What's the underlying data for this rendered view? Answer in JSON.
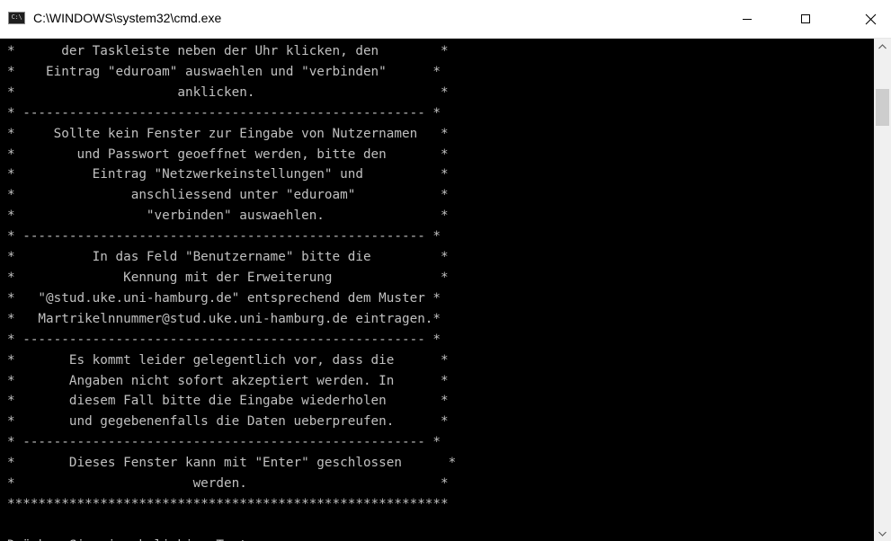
{
  "window": {
    "title": "C:\\WINDOWS\\system32\\cmd.exe",
    "icon": "cmd-icon",
    "icon_text": "C:\\"
  },
  "controls": {
    "minimize_icon": "minimize-icon",
    "maximize_icon": "maximize-icon",
    "close_icon": "close-icon"
  },
  "console": {
    "lines": [
      "*      der Taskleiste neben der Uhr klicken, den        *",
      "*    Eintrag \"eduroam\" auswaehlen und \"verbinden\"      *",
      "*                     anklicken.                        *",
      "* ---------------------------------------------------- *",
      "*     Sollte kein Fenster zur Eingabe von Nutzernamen   *",
      "*        und Passwort geoeffnet werden, bitte den       *",
      "*          Eintrag \"Netzwerkeinstellungen\" und          *",
      "*               anschliessend unter \"eduroam\"           *",
      "*                 \"verbinden\" auswaehlen.               *",
      "* ---------------------------------------------------- *",
      "*          In das Feld \"Benutzername\" bitte die         *",
      "*              Kennung mit der Erweiterung              *",
      "*   \"@stud.uke.uni-hamburg.de\" entsprechend dem Muster *",
      "*   Martrikelnnummer@stud.uke.uni-hamburg.de eintragen.*",
      "* ---------------------------------------------------- *",
      "*       Es kommt leider gelegentlich vor, dass die      *",
      "*       Angaben nicht sofort akzeptiert werden. In      *",
      "*       diesem Fall bitte die Eingabe wiederholen       *",
      "*       und gegebenenfalls die Daten ueberpreufen.      *",
      "* ---------------------------------------------------- *",
      "*       Dieses Fenster kann mit \"Enter\" geschlossen      *",
      "*                       werden.                         *",
      "*********************************************************",
      "",
      "Drücken Sie eine beliebige Taste . . . "
    ]
  },
  "scrollbar": {
    "up_icon": "scroll-up-arrow-icon",
    "down_icon": "scroll-down-arrow-icon"
  },
  "colors": {
    "console_background": "#000000",
    "console_text": "#c0c0c0",
    "titlebar_background": "#ffffff",
    "scrollbar_track": "#f0f0f0",
    "scrollbar_thumb": "#cdcdcd"
  }
}
